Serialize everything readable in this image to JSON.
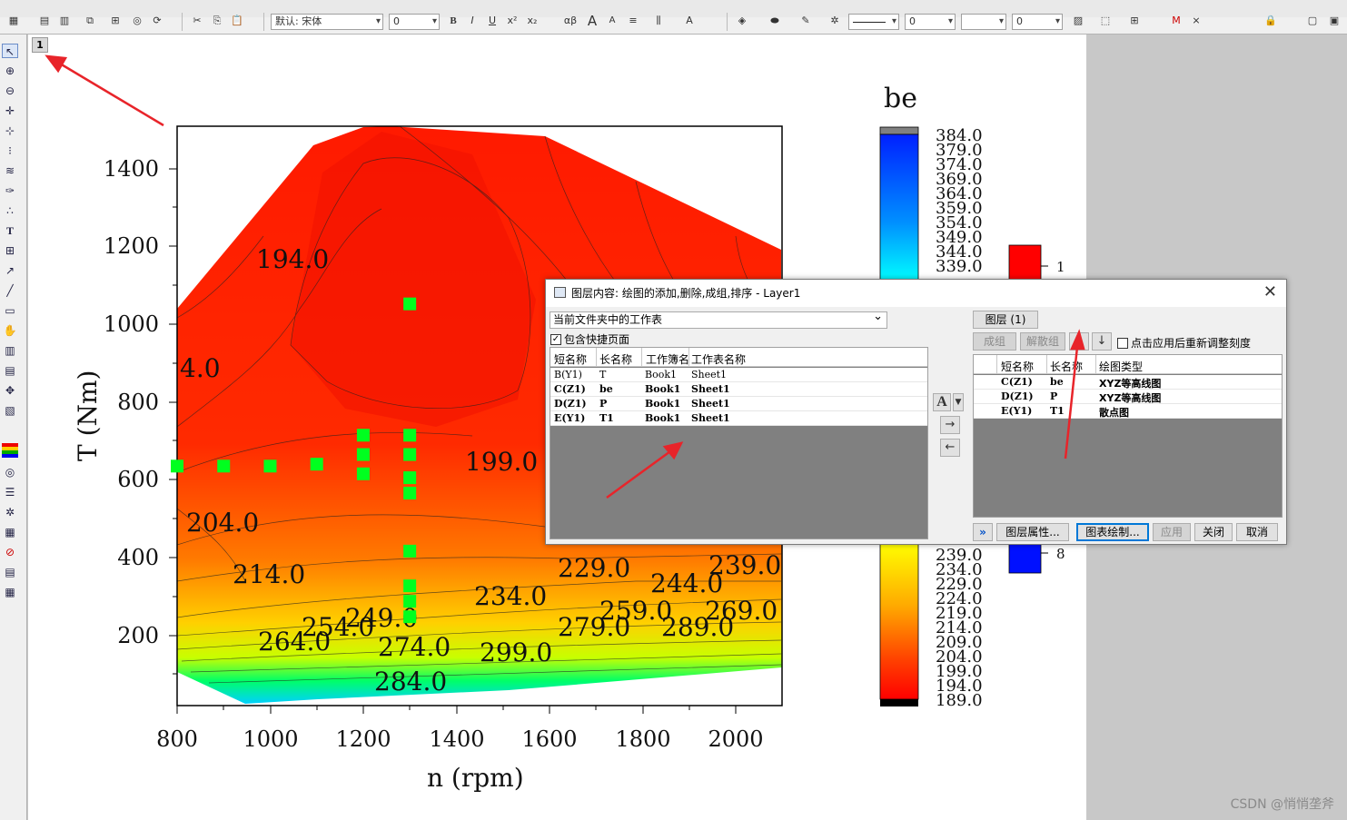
{
  "toolbar": {
    "font_name": "默认: 宋体",
    "font_size": "0",
    "line_width": "0",
    "line_size2": "0",
    "bold": "B",
    "italic": "I",
    "underline": "U",
    "superscript": "x²",
    "subscript": "x₂",
    "greek": "αβ",
    "font_grow": "A",
    "font_shrink": "A"
  },
  "layer_badge": "1",
  "plot": {
    "x_axis_label": "n (rpm)",
    "y_axis_label": "T (Nm)",
    "colorbar_title": "be",
    "x_ticks": [
      "800",
      "1000",
      "1200",
      "1400",
      "1600",
      "1800",
      "2000"
    ],
    "y_ticks": [
      "200",
      "400",
      "600",
      "800",
      "1000",
      "1200",
      "1400"
    ],
    "contour_labels": [
      "194.0",
      "4.0",
      "199.0",
      "204.0",
      "214.0",
      "229.0",
      "244.0",
      "239.0",
      "234.0",
      "259.0",
      "269.0",
      "279.0",
      "289.0",
      "264.0",
      "254.0",
      "249.0",
      "274.0",
      "284.0",
      "299.0"
    ],
    "colorbar_upper": [
      "384.0",
      "379.0",
      "374.0",
      "369.0",
      "364.0",
      "359.0",
      "354.0",
      "349.0",
      "344.0",
      "339.0"
    ],
    "colorbar_lower": [
      "239.0",
      "234.0",
      "229.0",
      "224.0",
      "219.0",
      "214.0",
      "209.0",
      "204.0",
      "199.0",
      "194.0",
      "189.0"
    ],
    "legend_top_label": "1",
    "legend_bottom_label": "8"
  },
  "chart_data": {
    "type": "contour",
    "xlabel": "n (rpm)",
    "ylabel": "T (Nm)",
    "xlim": [
      800,
      2100
    ],
    "ylim": [
      0,
      1500
    ],
    "colorbar": {
      "title": "be",
      "range": [
        189.0,
        384.0
      ],
      "step": 5
    },
    "scatter_points": [
      {
        "x": 800,
        "y": 620
      },
      {
        "x": 900,
        "y": 620
      },
      {
        "x": 1000,
        "y": 620
      },
      {
        "x": 1100,
        "y": 625
      },
      {
        "x": 1200,
        "y": 600
      },
      {
        "x": 1200,
        "y": 650
      },
      {
        "x": 1200,
        "y": 700
      },
      {
        "x": 1300,
        "y": 1040
      },
      {
        "x": 1300,
        "y": 700
      },
      {
        "x": 1300,
        "y": 650
      },
      {
        "x": 1300,
        "y": 590
      },
      {
        "x": 1300,
        "y": 550
      },
      {
        "x": 1300,
        "y": 400
      },
      {
        "x": 1300,
        "y": 310
      },
      {
        "x": 1300,
        "y": 270
      },
      {
        "x": 1300,
        "y": 230
      }
    ]
  },
  "dialog": {
    "title": "图层内容: 绘图的添加,删除,成组,排序 - Layer1",
    "source_select": "当前文件夹中的工作表",
    "include_shortcut_label": "包含快捷页面",
    "left_headers": [
      "短名称",
      "长名称",
      "工作簿名",
      "工作表名称"
    ],
    "left_rows": [
      {
        "short": "B(Y1)",
        "long": "T",
        "book": "Book1",
        "sheet": "Sheet1"
      },
      {
        "short": "C(Z1)",
        "long": "be",
        "book": "Book1",
        "sheet": "Sheet1"
      },
      {
        "short": "D(Z1)",
        "long": "P",
        "book": "Book1",
        "sheet": "Sheet1"
      },
      {
        "short": "E(Y1)",
        "long": "T1",
        "book": "Book1",
        "sheet": "Sheet1"
      }
    ],
    "layer_button": "图层 (1)",
    "group_button": "成组",
    "ungroup_button": "解散组",
    "rescale_label": "点击应用后重新调整刻度",
    "right_headers": [
      "短名称",
      "长名称",
      "绘图类型"
    ],
    "right_rows": [
      {
        "short": "C(Z1)",
        "long": "be",
        "type": "XYZ等高线图"
      },
      {
        "short": "D(Z1)",
        "long": "P",
        "type": "XYZ等高线图"
      },
      {
        "short": "E(Y1)",
        "long": "T1",
        "type": "散点图"
      }
    ],
    "expand_button": "»",
    "layer_props_button": "图层属性...",
    "plot_setup_button": "图表绘制...",
    "apply_button": "应用",
    "close_button": "关闭",
    "cancel_button": "取消",
    "add_arrow": "→",
    "remove_arrow": "←",
    "up_arrow": "↑",
    "down_arrow": "↓",
    "font_a": "A"
  },
  "watermark": "CSDN @悄悄垄斧",
  "colors": {
    "annotation_arrow": "#e8242a",
    "scatter": "#00ff1f",
    "dialog_gray": "#808080"
  }
}
